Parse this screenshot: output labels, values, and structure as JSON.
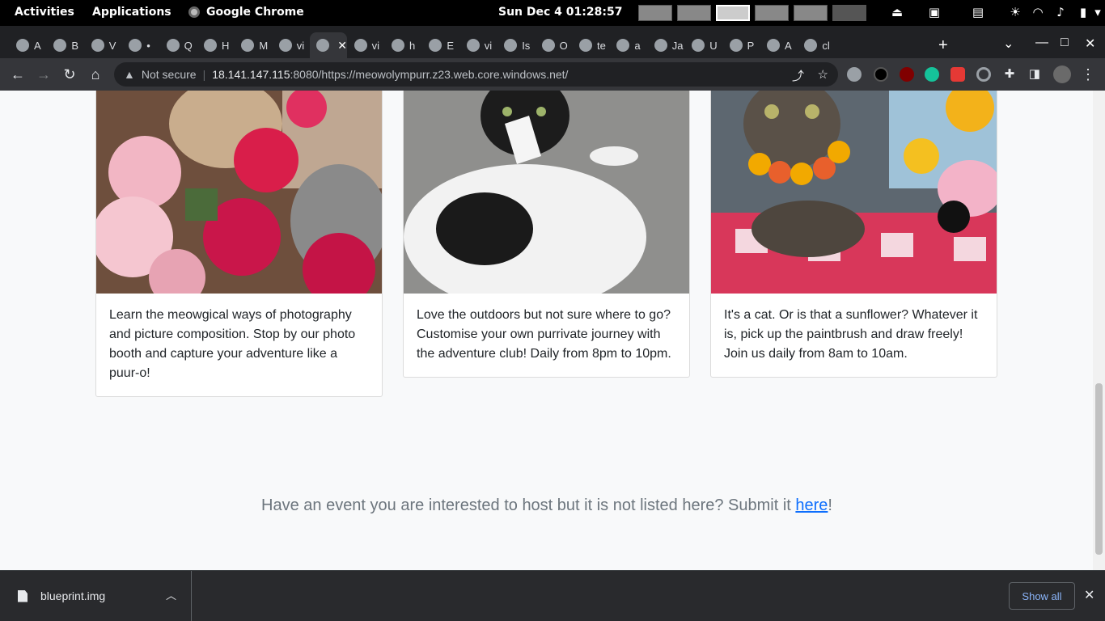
{
  "topbar": {
    "activities": "Activities",
    "applications": "Applications",
    "app_name": "Google Chrome",
    "clock": "Sun Dec 4  01:28:57"
  },
  "tabs": [
    {
      "label": "A"
    },
    {
      "label": "B"
    },
    {
      "label": "V"
    },
    {
      "label": "•"
    },
    {
      "label": "Q"
    },
    {
      "label": "H"
    },
    {
      "label": "M"
    },
    {
      "label": "vi"
    },
    {
      "label": ""
    },
    {
      "label": "vi"
    },
    {
      "label": "h"
    },
    {
      "label": "E"
    },
    {
      "label": "vi"
    },
    {
      "label": "Is"
    },
    {
      "label": "O"
    },
    {
      "label": "te"
    },
    {
      "label": "a"
    },
    {
      "label": "Ja"
    },
    {
      "label": "U"
    },
    {
      "label": "P"
    },
    {
      "label": "A"
    },
    {
      "label": "cl"
    }
  ],
  "toolbar": {
    "security_label": "Not secure",
    "url_host": "18.141.147.115",
    "url_rest": ":8080/https://meowolympurr.z23.web.core.windows.net/"
  },
  "cards": [
    {
      "text": "Learn the meowgical ways of photography and picture composition. Stop by our photo booth and capture your adventure like a puur-o!"
    },
    {
      "text": "Love the outdoors but not sure where to go? Customise your own purrivate journey with the adventure club! Daily from 8pm to 10pm."
    },
    {
      "text": "It's a cat. Or is that a sunflower? Whatever it is, pick up the paintbrush and draw freely! Join us daily from 8am to 10am."
    }
  ],
  "cta": {
    "prefix": "Have an event you are interested to host but it is not listed here? Submit it ",
    "link": "here",
    "suffix": "!"
  },
  "downloads": {
    "filename": "blueprint.img",
    "show_all": "Show all"
  }
}
